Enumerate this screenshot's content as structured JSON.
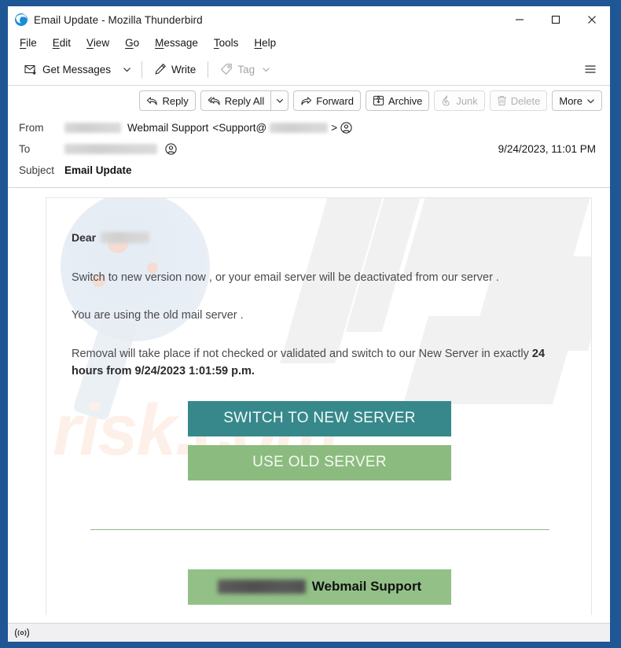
{
  "window": {
    "title": "Email Update - Mozilla Thunderbird",
    "app_icon": "thunderbird-icon",
    "controls": {
      "minimize": "minimize-icon",
      "maximize": "maximize-icon",
      "close": "close-icon"
    }
  },
  "menubar": {
    "items": [
      {
        "label": "File",
        "accesskey": "F"
      },
      {
        "label": "Edit",
        "accesskey": "E"
      },
      {
        "label": "View",
        "accesskey": "V"
      },
      {
        "label": "Go",
        "accesskey": "G"
      },
      {
        "label": "Message",
        "accesskey": "M"
      },
      {
        "label": "Tools",
        "accesskey": "T"
      },
      {
        "label": "Help",
        "accesskey": "H"
      }
    ]
  },
  "toolbar": {
    "get_messages_label": "Get Messages",
    "write_label": "Write",
    "tag_label": "Tag",
    "tag_disabled": true,
    "app_menu_icon": "hamburger-icon"
  },
  "message_actions": [
    {
      "label": "Reply",
      "icon": "reply-icon",
      "disabled": false,
      "split": false
    },
    {
      "label": "Reply All",
      "icon": "reply-all-icon",
      "disabled": false,
      "split": true
    },
    {
      "label": "Forward",
      "icon": "forward-icon",
      "disabled": false,
      "split": false
    },
    {
      "label": "Archive",
      "icon": "archive-icon",
      "disabled": false,
      "split": false
    },
    {
      "label": "Junk",
      "icon": "junk-icon",
      "disabled": true,
      "split": false
    },
    {
      "label": "Delete",
      "icon": "trash-icon",
      "disabled": true,
      "split": false
    },
    {
      "label": "More",
      "icon": "chevron-down-icon",
      "disabled": false,
      "split": false
    }
  ],
  "headers": {
    "from_label": "From",
    "from_display_name": "Webmail Support",
    "from_address_prefix": "<Support@",
    "from_address_suffix": ">",
    "from_redacted": true,
    "to_label": "To",
    "to_redacted": true,
    "subject_label": "Subject",
    "subject_value": "Email Update",
    "date": "9/24/2023, 11:01 PM"
  },
  "email_body": {
    "greeting_label": "Dear",
    "greeting_redacted": true,
    "paragraph_1": "Switch to new version now  , or your email server will be deactivated from our server .",
    "paragraph_2": "You  are using the old  mail server .",
    "paragraph_3_lead": "Removal will take place if not checked or validated and switch to our New Server in exactly ",
    "paragraph_3_bold": "24 hours from 9/24/2023 1:01:59 p.m.",
    "cta_primary": "SWITCH TO NEW SERVER",
    "cta_secondary": "USE OLD SERVER",
    "footer_signature": "Webmail Support",
    "footer_redacted": true,
    "colors": {
      "cta_primary_bg": "#37888a",
      "cta_secondary_bg": "#8cbb80",
      "footer_bg": "#93c087",
      "divider": "#8cbb80"
    },
    "watermark_text": "risk.com"
  },
  "statusbar": {
    "connection_icon": "broadcast-icon"
  }
}
